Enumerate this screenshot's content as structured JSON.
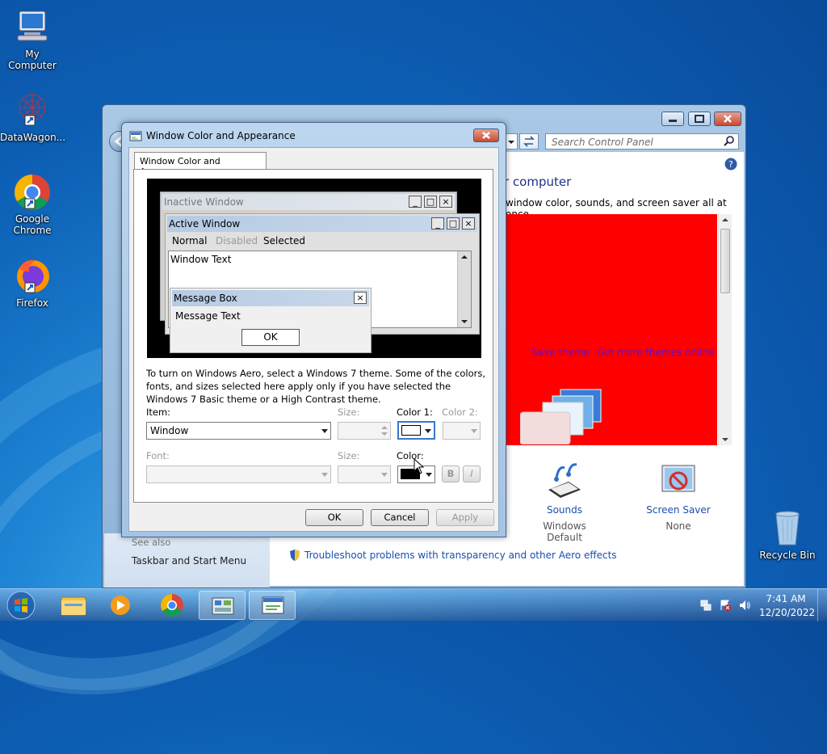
{
  "desktop": {
    "icons": [
      {
        "label": "My Computer"
      },
      {
        "label": "DataWagon..."
      },
      {
        "label": "Google Chrome"
      },
      {
        "label": "Firefox"
      },
      {
        "label": "Recycle Bin"
      }
    ]
  },
  "control_panel": {
    "search_placeholder": "Search Control Panel",
    "heading_partial": "r computer",
    "subtitle_partial": "window color, sounds, and screen saver all at once.",
    "save_theme": "Save theme",
    "get_more_themes": "Get more themes online",
    "sounds_label": "Sounds",
    "sounds_value": "Windows Default",
    "screensaver_label": "Screen Saver",
    "screensaver_value": "None",
    "see_also": "See also",
    "taskbar_link": "Taskbar and Start Menu",
    "troubleshoot_link": "Troubleshoot problems with transparency and other Aero effects",
    "theme_bg_color": "#ff0000"
  },
  "dialog": {
    "title": "Window Color and Appearance",
    "tab_label": "Window Color and Appearance",
    "preview": {
      "inactive_title": "Inactive Window",
      "active_title": "Active Window",
      "menu_normal": "Normal",
      "menu_disabled": "Disabled",
      "menu_selected": "Selected",
      "window_text": "Window Text",
      "msgbox_title": "Message Box",
      "msgbox_text": "Message Text",
      "msgbox_ok": "OK"
    },
    "description": "To turn on Windows Aero, select a Windows 7 theme.  Some of the colors, fonts, and sizes selected here apply only if you have selected the Windows 7 Basic theme or a High Contrast theme.",
    "item_label": "Item:",
    "item_value": "Window",
    "size_label": "Size:",
    "color1_label": "Color 1:",
    "color2_label": "Color 2:",
    "font_label": "Font:",
    "font_size_label": "Size:",
    "color_label": "Color:",
    "bold_label": "B",
    "italic_label": "I",
    "ok_label": "OK",
    "cancel_label": "Cancel",
    "apply_label": "Apply",
    "color1_value": "#ffffff",
    "color_value": "#000000"
  },
  "taskbar": {
    "time": "7:41 AM",
    "date": "12/20/2022"
  }
}
